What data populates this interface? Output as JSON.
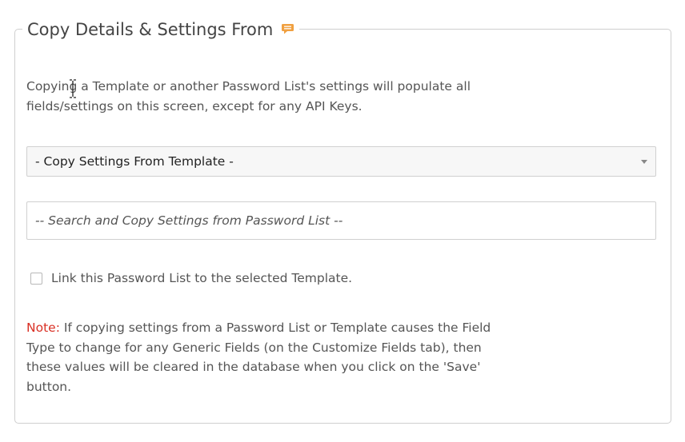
{
  "section": {
    "title": "Copy Details & Settings From",
    "help_icon": "speech-bubble-icon",
    "description_line1": "Copying a Template or another Password List's settings will populate all",
    "description_line2": "fields/settings on this screen, except for any API Keys."
  },
  "template_select": {
    "selected": "- Copy Settings From Template -"
  },
  "password_list_search": {
    "placeholder": "-- Search and Copy Settings from Password List --"
  },
  "link_checkbox": {
    "checked": false,
    "label": "Link this Password List to the selected Template."
  },
  "note": {
    "label": "Note:",
    "line1": " If copying settings from a Password List or Template causes the Field",
    "line2": "Type to change for any Generic Fields (on the Customize Fields tab), then",
    "line3": "these values will be cleared in the database when you click on the 'Save'",
    "line4": "button."
  },
  "colors": {
    "note_label": "#d93025",
    "help_icon": "#f0a040"
  }
}
